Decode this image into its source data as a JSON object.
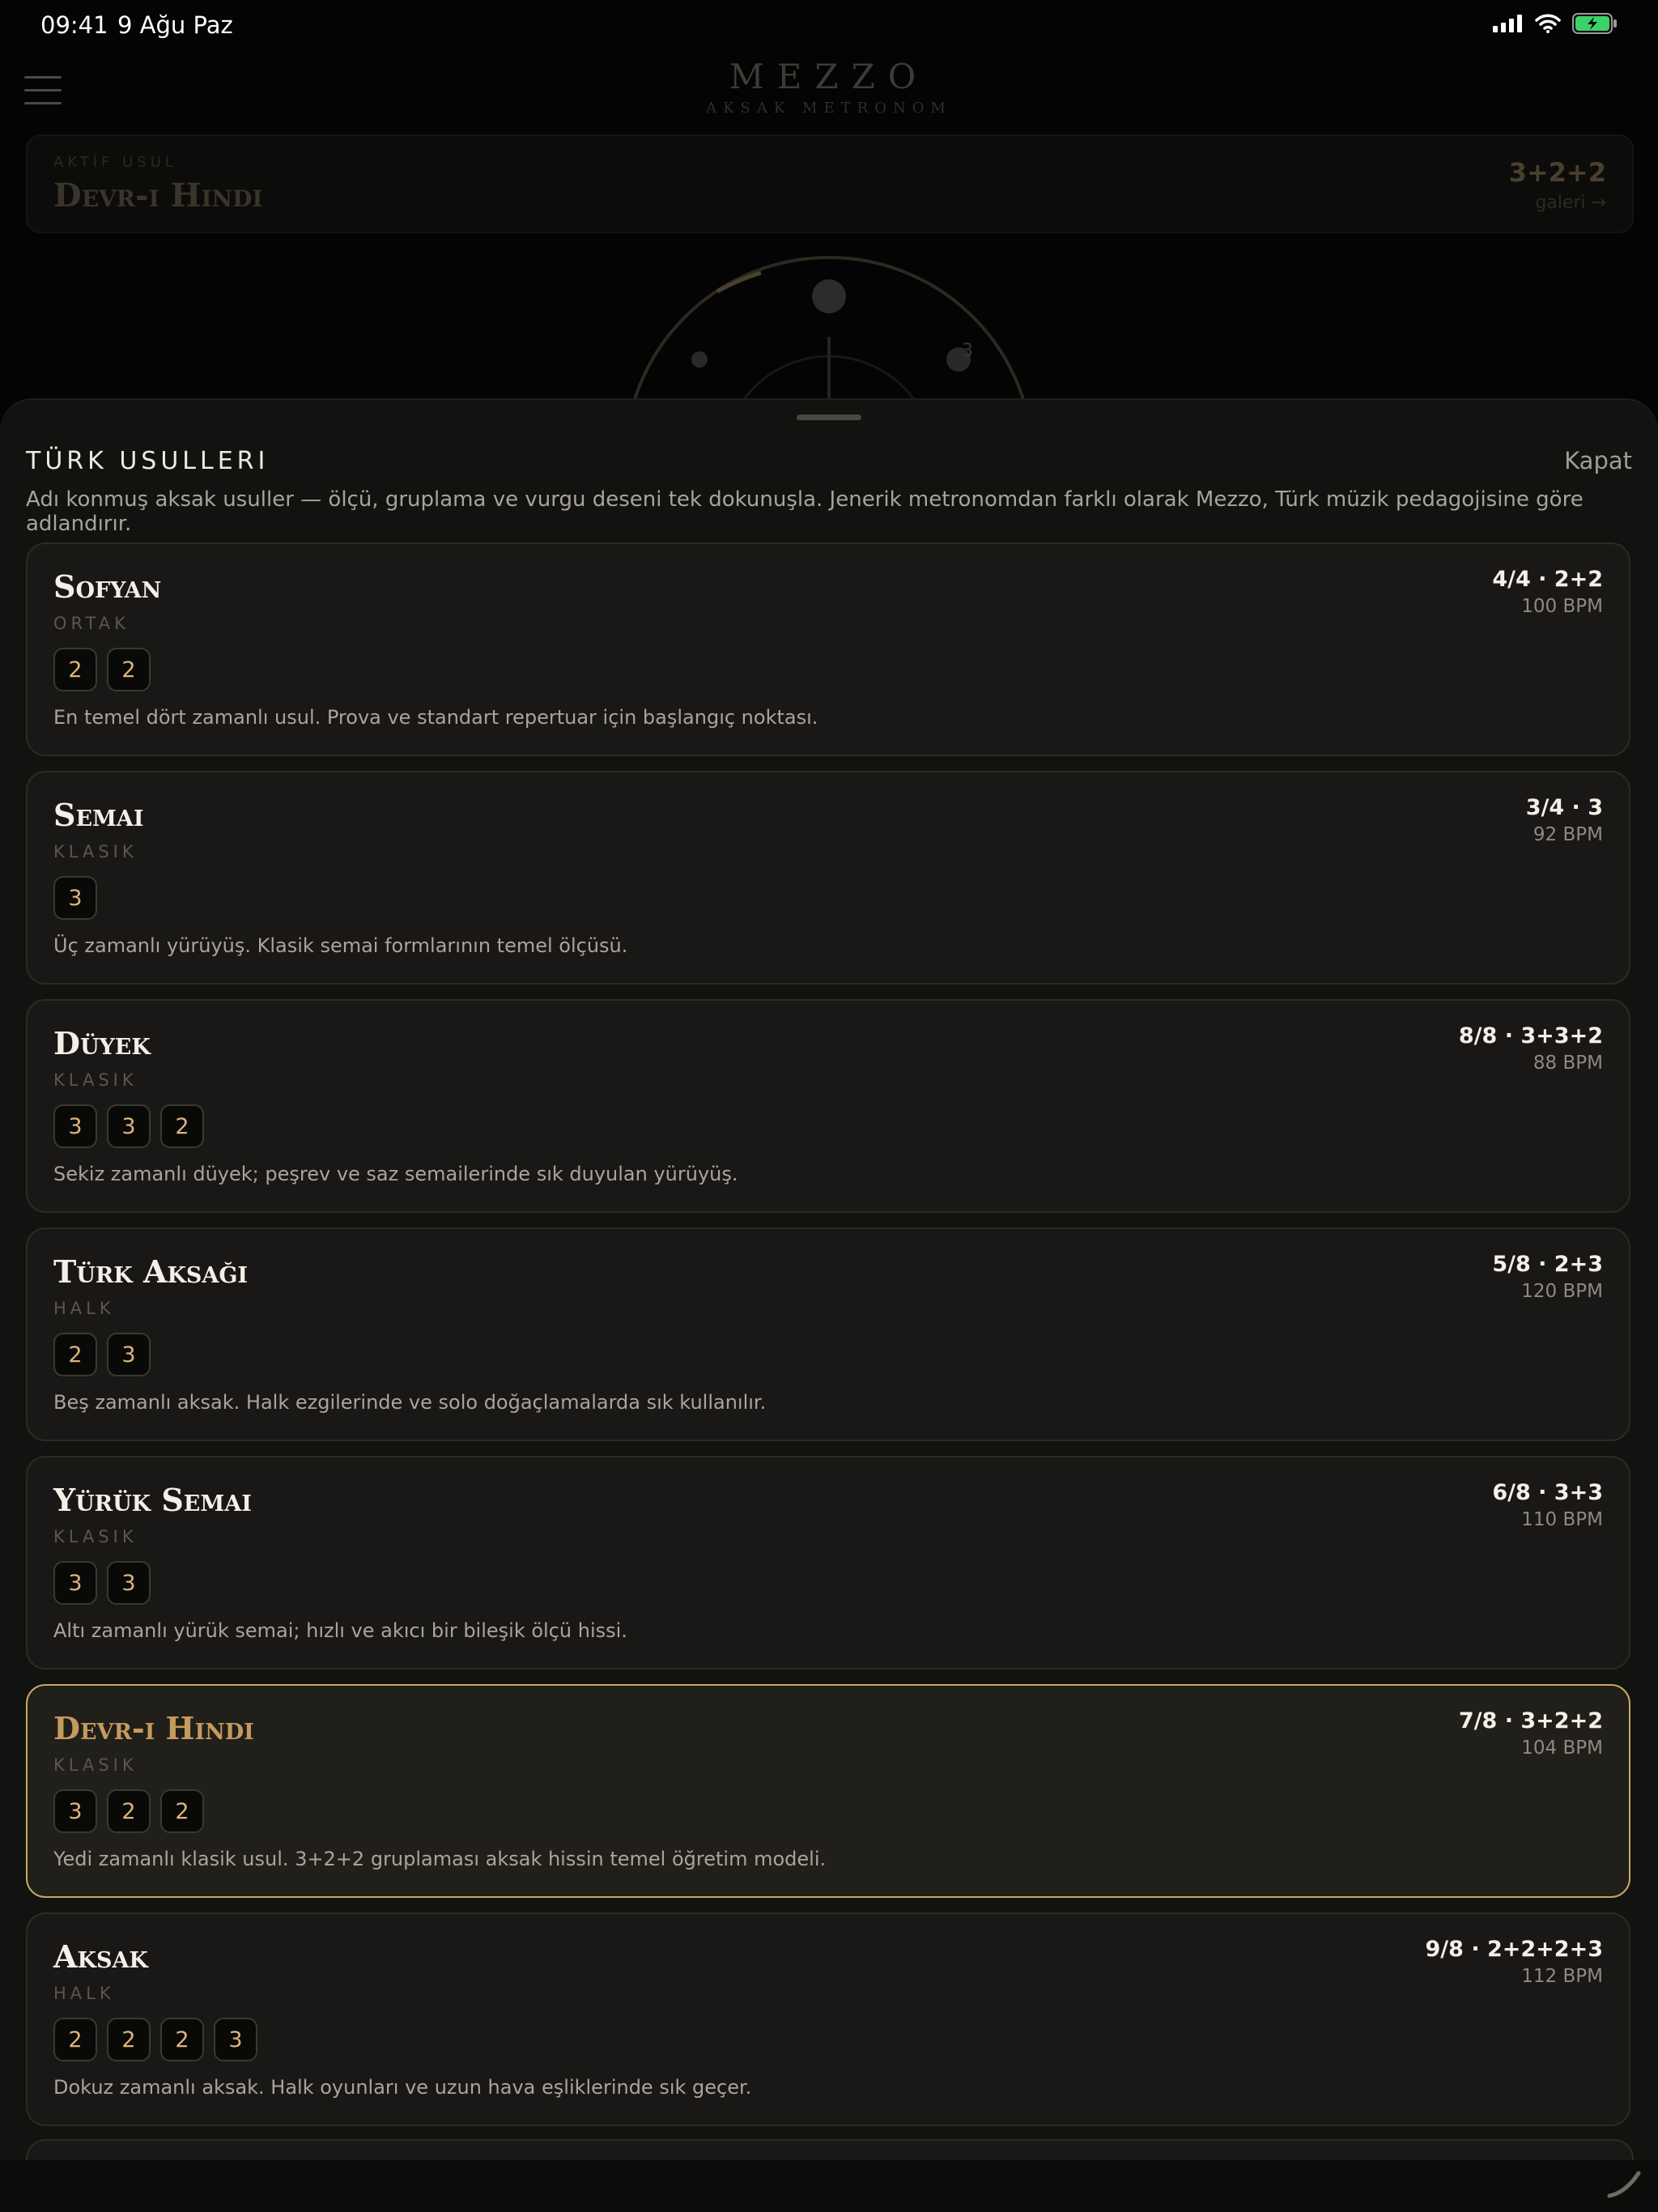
{
  "status_bar": {
    "time": "09:41",
    "date": "9 Ağu Paz"
  },
  "header": {
    "brand": "MEZZO",
    "subtitle": "AKSAK METRONOM"
  },
  "active": {
    "label": "AKTİF USUL",
    "name": "Devr-i Hindi",
    "meter": "3+2+2",
    "gallery": "galeri →"
  },
  "dial": {
    "beat_label": "3"
  },
  "sheet": {
    "title": "TÜRK USULLERI",
    "close": "Kapat",
    "description": "Adı konmuş aksak usuller — ölçü, gruplama ve vurgu deseni tek dokunuşla. Jenerik metronomdan farklı olarak Mezzo, Türk müzik pedagojisine göre adlandırır.",
    "items": [
      {
        "name": "Sofyan",
        "category": "ORTAK",
        "meter": "4/4 · 2+2",
        "bpm": "100 BPM",
        "groups": [
          "2",
          "2"
        ],
        "description": "En temel dört zamanlı usul. Prova ve standart repertuar için başlangıç noktası."
      },
      {
        "name": "Semai",
        "category": "KLASIK",
        "meter": "3/4 · 3",
        "bpm": "92 BPM",
        "groups": [
          "3"
        ],
        "description": "Üç zamanlı yürüyüş. Klasik semai formlarının temel ölçüsü."
      },
      {
        "name": "Düyek",
        "category": "KLASIK",
        "meter": "8/8 · 3+3+2",
        "bpm": "88 BPM",
        "groups": [
          "3",
          "3",
          "2"
        ],
        "description": "Sekiz zamanlı düyek; peşrev ve saz semailerinde sık duyulan yürüyüş."
      },
      {
        "name": "Türk Aksağı",
        "category": "HALK",
        "meter": "5/8 · 2+3",
        "bpm": "120 BPM",
        "groups": [
          "2",
          "3"
        ],
        "description": "Beş zamanlı aksak. Halk ezgilerinde ve solo doğaçlamalarda sık kullanılır."
      },
      {
        "name": "Yürük Semai",
        "category": "KLASIK",
        "meter": "6/8 · 3+3",
        "bpm": "110 BPM",
        "groups": [
          "3",
          "3"
        ],
        "description": "Altı zamanlı yürük semai; hızlı ve akıcı bir bileşik ölçü hissi."
      },
      {
        "name": "Devr-i Hindi",
        "category": "KLASIK",
        "meter": "7/8 · 3+2+2",
        "bpm": "104 BPM",
        "groups": [
          "3",
          "2",
          "2"
        ],
        "description": "Yedi zamanlı klasik usul. 3+2+2 gruplaması aksak hissin temel öğretim modeli.",
        "selected": true
      },
      {
        "name": "Aksak",
        "category": "HALK",
        "meter": "9/8 · 2+2+2+3",
        "bpm": "112 BPM",
        "groups": [
          "2",
          "2",
          "2",
          "3"
        ],
        "description": "Dokuz zamanlı aksak. Halk oyunları ve uzun hava eşliklerinde sık geçer."
      }
    ]
  },
  "colors": {
    "accent": "#c9a766",
    "chip_text": "#ddb47c",
    "selected_name": "#c59a5d",
    "background": "#040404",
    "sheet": "#121210"
  },
  "icons": [
    "signal-icon",
    "wifi-icon",
    "battery-icon",
    "menu-icon",
    "resize-handle-icon"
  ]
}
